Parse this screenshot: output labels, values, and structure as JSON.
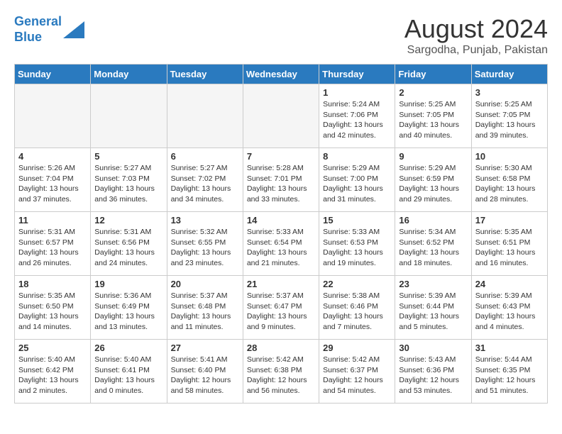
{
  "header": {
    "logo_line1": "General",
    "logo_line2": "Blue",
    "month_title": "August 2024",
    "location": "Sargodha, Punjab, Pakistan"
  },
  "days_of_week": [
    "Sunday",
    "Monday",
    "Tuesday",
    "Wednesday",
    "Thursday",
    "Friday",
    "Saturday"
  ],
  "weeks": [
    [
      {
        "day": "",
        "info": ""
      },
      {
        "day": "",
        "info": ""
      },
      {
        "day": "",
        "info": ""
      },
      {
        "day": "",
        "info": ""
      },
      {
        "day": "1",
        "info": "Sunrise: 5:24 AM\nSunset: 7:06 PM\nDaylight: 13 hours\nand 42 minutes."
      },
      {
        "day": "2",
        "info": "Sunrise: 5:25 AM\nSunset: 7:05 PM\nDaylight: 13 hours\nand 40 minutes."
      },
      {
        "day": "3",
        "info": "Sunrise: 5:25 AM\nSunset: 7:05 PM\nDaylight: 13 hours\nand 39 minutes."
      }
    ],
    [
      {
        "day": "4",
        "info": "Sunrise: 5:26 AM\nSunset: 7:04 PM\nDaylight: 13 hours\nand 37 minutes."
      },
      {
        "day": "5",
        "info": "Sunrise: 5:27 AM\nSunset: 7:03 PM\nDaylight: 13 hours\nand 36 minutes."
      },
      {
        "day": "6",
        "info": "Sunrise: 5:27 AM\nSunset: 7:02 PM\nDaylight: 13 hours\nand 34 minutes."
      },
      {
        "day": "7",
        "info": "Sunrise: 5:28 AM\nSunset: 7:01 PM\nDaylight: 13 hours\nand 33 minutes."
      },
      {
        "day": "8",
        "info": "Sunrise: 5:29 AM\nSunset: 7:00 PM\nDaylight: 13 hours\nand 31 minutes."
      },
      {
        "day": "9",
        "info": "Sunrise: 5:29 AM\nSunset: 6:59 PM\nDaylight: 13 hours\nand 29 minutes."
      },
      {
        "day": "10",
        "info": "Sunrise: 5:30 AM\nSunset: 6:58 PM\nDaylight: 13 hours\nand 28 minutes."
      }
    ],
    [
      {
        "day": "11",
        "info": "Sunrise: 5:31 AM\nSunset: 6:57 PM\nDaylight: 13 hours\nand 26 minutes."
      },
      {
        "day": "12",
        "info": "Sunrise: 5:31 AM\nSunset: 6:56 PM\nDaylight: 13 hours\nand 24 minutes."
      },
      {
        "day": "13",
        "info": "Sunrise: 5:32 AM\nSunset: 6:55 PM\nDaylight: 13 hours\nand 23 minutes."
      },
      {
        "day": "14",
        "info": "Sunrise: 5:33 AM\nSunset: 6:54 PM\nDaylight: 13 hours\nand 21 minutes."
      },
      {
        "day": "15",
        "info": "Sunrise: 5:33 AM\nSunset: 6:53 PM\nDaylight: 13 hours\nand 19 minutes."
      },
      {
        "day": "16",
        "info": "Sunrise: 5:34 AM\nSunset: 6:52 PM\nDaylight: 13 hours\nand 18 minutes."
      },
      {
        "day": "17",
        "info": "Sunrise: 5:35 AM\nSunset: 6:51 PM\nDaylight: 13 hours\nand 16 minutes."
      }
    ],
    [
      {
        "day": "18",
        "info": "Sunrise: 5:35 AM\nSunset: 6:50 PM\nDaylight: 13 hours\nand 14 minutes."
      },
      {
        "day": "19",
        "info": "Sunrise: 5:36 AM\nSunset: 6:49 PM\nDaylight: 13 hours\nand 13 minutes."
      },
      {
        "day": "20",
        "info": "Sunrise: 5:37 AM\nSunset: 6:48 PM\nDaylight: 13 hours\nand 11 minutes."
      },
      {
        "day": "21",
        "info": "Sunrise: 5:37 AM\nSunset: 6:47 PM\nDaylight: 13 hours\nand 9 minutes."
      },
      {
        "day": "22",
        "info": "Sunrise: 5:38 AM\nSunset: 6:46 PM\nDaylight: 13 hours\nand 7 minutes."
      },
      {
        "day": "23",
        "info": "Sunrise: 5:39 AM\nSunset: 6:44 PM\nDaylight: 13 hours\nand 5 minutes."
      },
      {
        "day": "24",
        "info": "Sunrise: 5:39 AM\nSunset: 6:43 PM\nDaylight: 13 hours\nand 4 minutes."
      }
    ],
    [
      {
        "day": "25",
        "info": "Sunrise: 5:40 AM\nSunset: 6:42 PM\nDaylight: 13 hours\nand 2 minutes."
      },
      {
        "day": "26",
        "info": "Sunrise: 5:40 AM\nSunset: 6:41 PM\nDaylight: 13 hours\nand 0 minutes."
      },
      {
        "day": "27",
        "info": "Sunrise: 5:41 AM\nSunset: 6:40 PM\nDaylight: 12 hours\nand 58 minutes."
      },
      {
        "day": "28",
        "info": "Sunrise: 5:42 AM\nSunset: 6:38 PM\nDaylight: 12 hours\nand 56 minutes."
      },
      {
        "day": "29",
        "info": "Sunrise: 5:42 AM\nSunset: 6:37 PM\nDaylight: 12 hours\nand 54 minutes."
      },
      {
        "day": "30",
        "info": "Sunrise: 5:43 AM\nSunset: 6:36 PM\nDaylight: 12 hours\nand 53 minutes."
      },
      {
        "day": "31",
        "info": "Sunrise: 5:44 AM\nSunset: 6:35 PM\nDaylight: 12 hours\nand 51 minutes."
      }
    ]
  ]
}
